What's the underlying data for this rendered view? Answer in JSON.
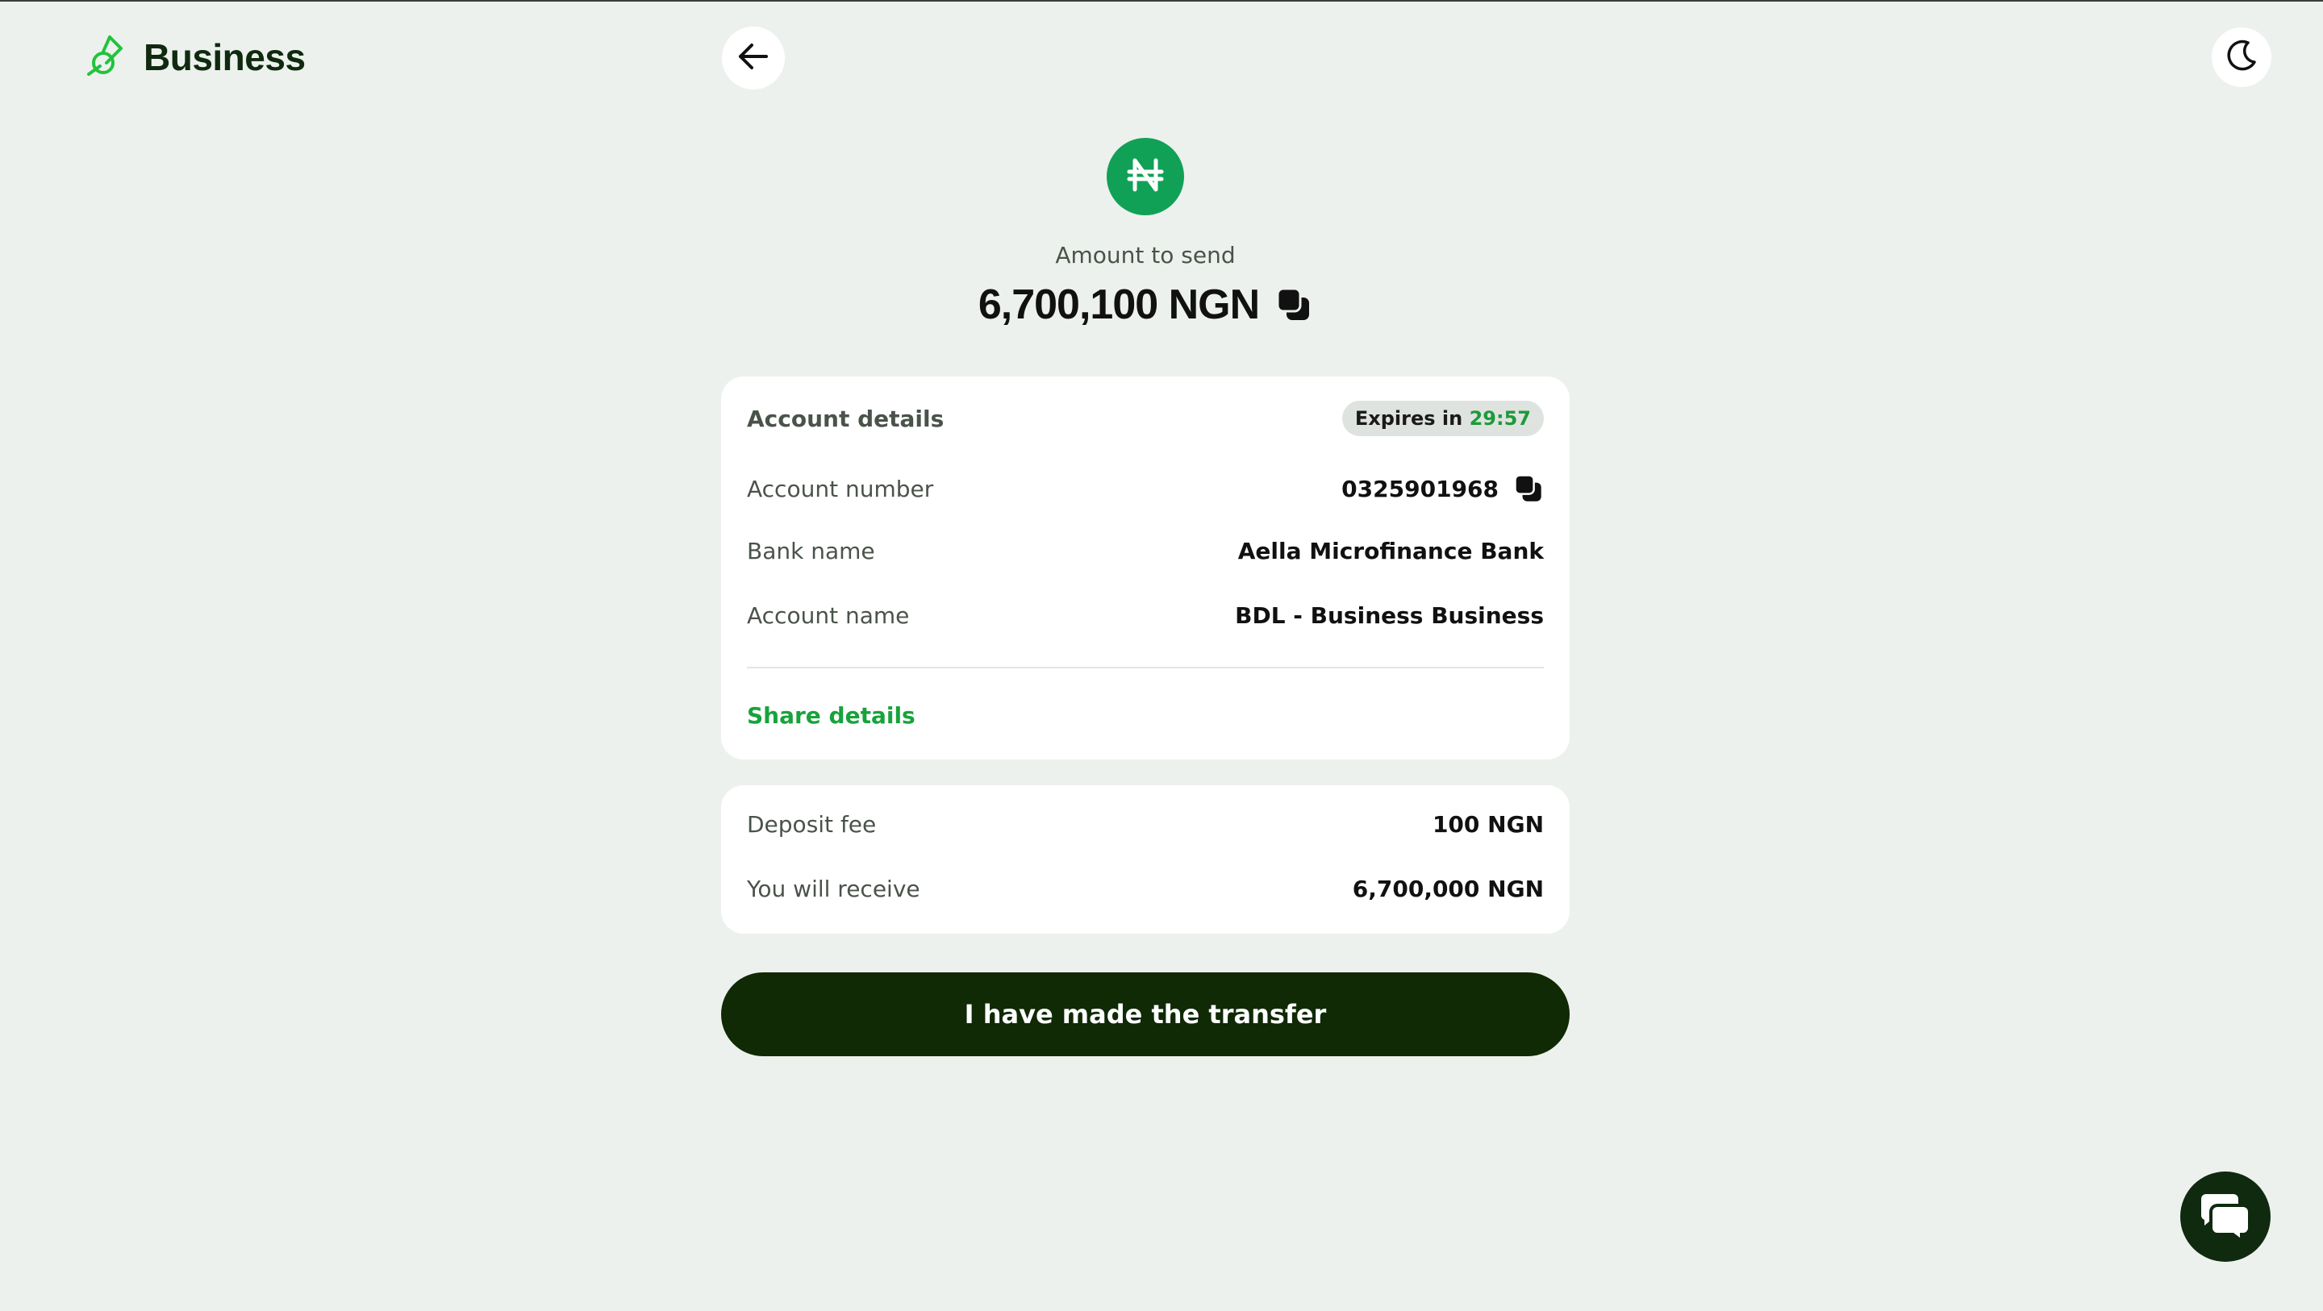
{
  "header": {
    "brand": "Business",
    "icons": {
      "logo": "brand-logo-icon",
      "back": "arrow-left-icon",
      "theme": "moon-icon"
    }
  },
  "summary": {
    "currency_icon": "naira-icon",
    "amount_label": "Amount to send",
    "amount_value": "6,700,100 NGN",
    "copy_icon": "copy-icon"
  },
  "account_card": {
    "title": "Account details",
    "expires_prefix": "Expires in",
    "expires_time": "29:57",
    "rows": [
      {
        "label": "Account number",
        "value": "0325901968"
      },
      {
        "label": "Bank name",
        "value": "Aella Microfinance Bank"
      },
      {
        "label": "Account name",
        "value": "BDL - Business Business"
      }
    ],
    "share_label": "Share details"
  },
  "fees_card": {
    "rows": [
      {
        "label": "Deposit fee",
        "value": "100 NGN"
      },
      {
        "label": "You will receive",
        "value": "6,700,000 NGN"
      }
    ]
  },
  "actions": {
    "confirm_label": "I have made the transfer"
  },
  "chat": {
    "icon": "chat-bubbles-icon"
  },
  "colors": {
    "background": "#edf1ed",
    "brand_green": "#17a33b",
    "badge_green": "#11a156",
    "dark_green": "#0f2a04",
    "card": "#ffffff"
  }
}
